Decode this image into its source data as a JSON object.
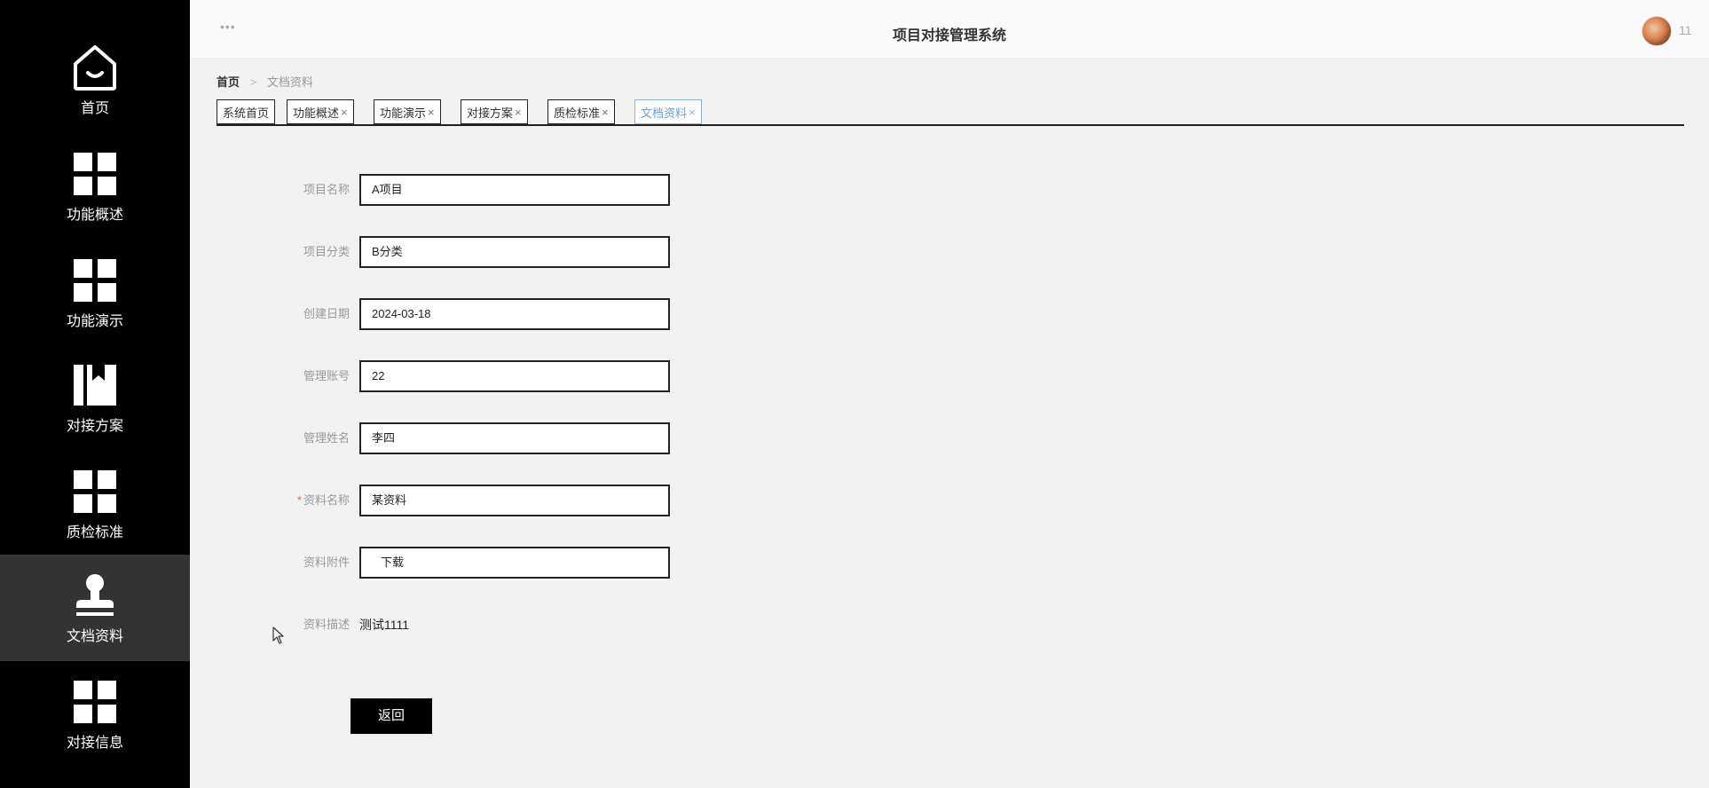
{
  "header": {
    "title": "项目对接管理系统",
    "menu_glyph": "•••",
    "user_number": "11"
  },
  "sidebar": {
    "items": [
      {
        "label": "首页",
        "icon": "home-icon"
      },
      {
        "label": "功能概述",
        "icon": "grid-icon"
      },
      {
        "label": "功能演示",
        "icon": "grid-icon"
      },
      {
        "label": "对接方案",
        "icon": "book-icon"
      },
      {
        "label": "质检标准",
        "icon": "grid-icon"
      },
      {
        "label": "文档资料",
        "icon": "stamp-icon",
        "active": true
      },
      {
        "label": "对接信息",
        "icon": "grid-icon"
      }
    ]
  },
  "breadcrumb": {
    "home": "首页",
    "separator": ">",
    "current": "文档资料"
  },
  "tabs": [
    {
      "label": "系统首页",
      "close": ""
    },
    {
      "label": "功能概述",
      "close": "×"
    },
    {
      "label": "功能演示",
      "close": "×"
    },
    {
      "label": "对接方案",
      "close": "×"
    },
    {
      "label": "质检标准",
      "close": "×"
    },
    {
      "label": "文档资料",
      "close": "×",
      "active": true
    }
  ],
  "form": {
    "project_name": {
      "label": "项目名称",
      "value": "A项目"
    },
    "project_category": {
      "label": "项目分类",
      "value": "B分类"
    },
    "create_date": {
      "label": "创建日期",
      "value": "2024-03-18"
    },
    "admin_account": {
      "label": "管理账号",
      "value": "22"
    },
    "admin_name": {
      "label": "管理姓名",
      "value": "李四"
    },
    "doc_name": {
      "label": "资料名称",
      "required_mark": "*",
      "value": "某资料"
    },
    "doc_attachment": {
      "label": "资料附件",
      "value": "下载"
    },
    "doc_description": {
      "label": "资料描述",
      "value": "测试1111"
    }
  },
  "buttons": {
    "back": "返回"
  },
  "colors": {
    "sidebar_bg": "#000000",
    "sidebar_active_bg": "#333333",
    "main_bg": "#f2f2f2",
    "active_tab": "#8ab4e0",
    "required": "#e85a5a"
  }
}
